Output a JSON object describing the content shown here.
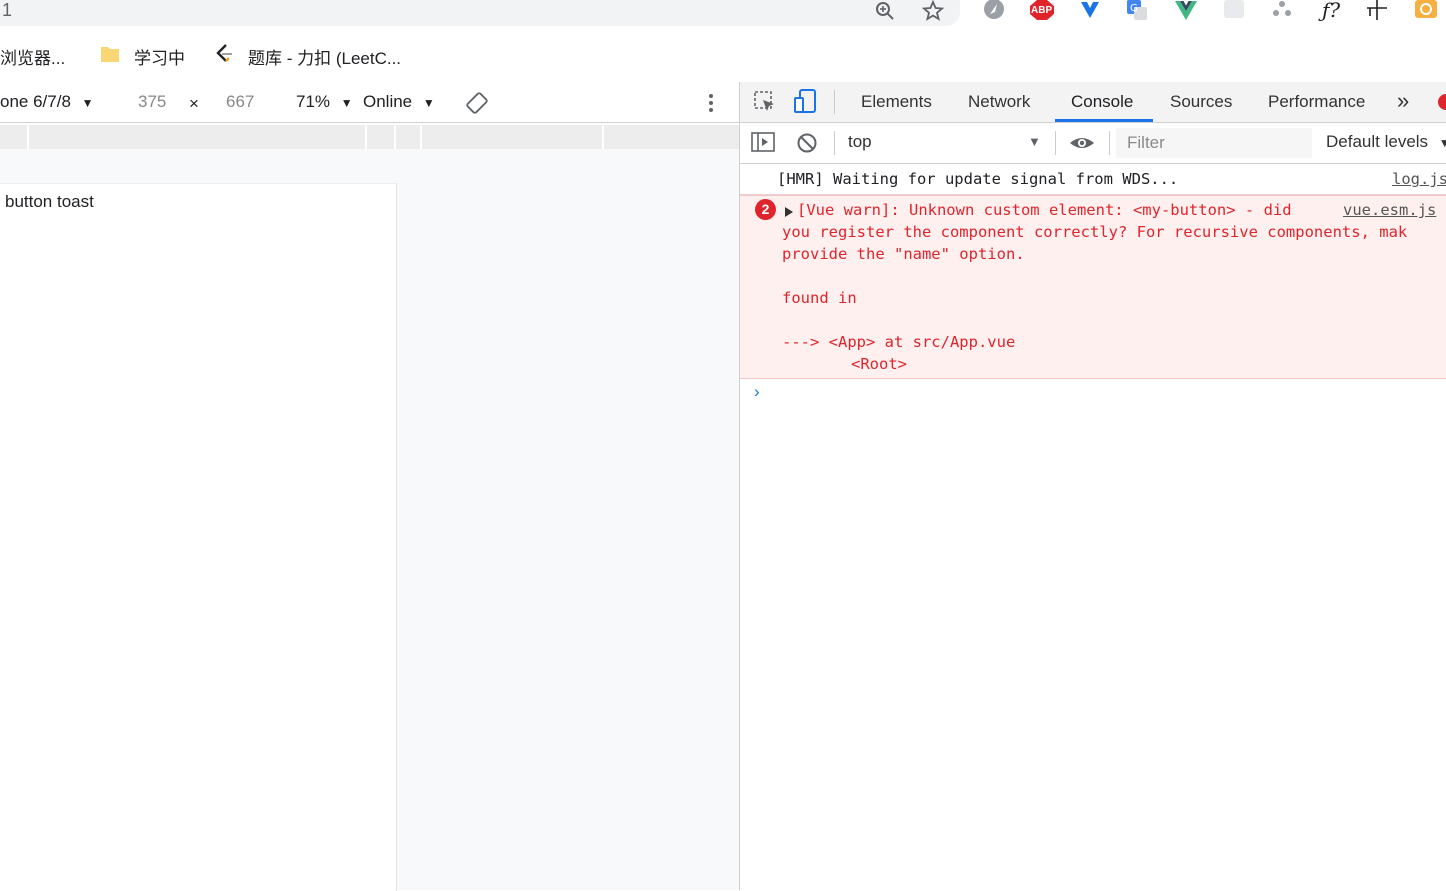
{
  "omnibox": {
    "text": "1"
  },
  "toolbar_icons": [
    "zoom-icon",
    "star-icon",
    "extension-icon",
    "adblock-icon",
    "extension-icon",
    "translate-icon",
    "vue-devtools-icon",
    "extension-icon",
    "extension-icon",
    "formula-icon",
    "crop-icon",
    "extension-icon"
  ],
  "toolbar_labels": {
    "abp": "ABP",
    "formula": "ƒ?"
  },
  "bookmarks": {
    "items": [
      {
        "label": "浏览器..."
      },
      {
        "label": "学习中"
      },
      {
        "label": "题库 - 力扣 (LeetC..."
      }
    ]
  },
  "device_toolbar": {
    "device": "one 6/7/8",
    "width": "375",
    "times": "×",
    "height": "667",
    "zoom": "71%",
    "network": "Online",
    "caret": "▼"
  },
  "page": {
    "content_text": "button toast"
  },
  "devtools": {
    "tabs": [
      {
        "label": "Elements"
      },
      {
        "label": "Network"
      },
      {
        "label": "Console",
        "active": true
      },
      {
        "label": "Sources"
      },
      {
        "label": "Performance"
      }
    ],
    "more_tabs": "»",
    "console_bar": {
      "context": "top",
      "filter_placeholder": "Filter",
      "levels": "Default levels"
    },
    "console": {
      "log_message": "[HMR] Waiting for update signal from WDS...",
      "log_source": "log.js",
      "error_count": "2",
      "error_line1": "[Vue warn]: Unknown custom element: <my-button> - did",
      "error_source": "vue.esm.js",
      "error_line2": "you register the component correctly? For recursive components, mak",
      "error_line3": "provide the \"name\" option.",
      "error_line4": "found in",
      "error_line5": "---> <App> at src/App.vue",
      "error_line6": "<Root>",
      "prompt": "›"
    }
  },
  "colors": {
    "accent": "#1a73e8",
    "error": "#e0242b",
    "error_bg": "#fff0f0"
  }
}
